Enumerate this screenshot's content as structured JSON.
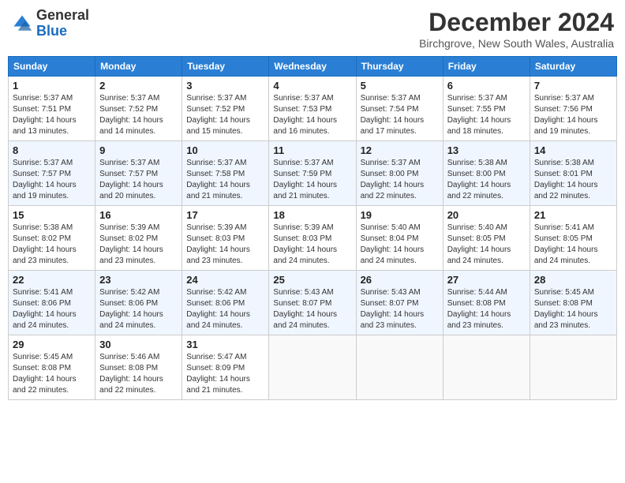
{
  "logo": {
    "general": "General",
    "blue": "Blue"
  },
  "header": {
    "month": "December 2024",
    "location": "Birchgrove, New South Wales, Australia"
  },
  "weekdays": [
    "Sunday",
    "Monday",
    "Tuesday",
    "Wednesday",
    "Thursday",
    "Friday",
    "Saturday"
  ],
  "weeks": [
    [
      {
        "day": "1",
        "info": "Sunrise: 5:37 AM\nSunset: 7:51 PM\nDaylight: 14 hours\nand 13 minutes."
      },
      {
        "day": "2",
        "info": "Sunrise: 5:37 AM\nSunset: 7:52 PM\nDaylight: 14 hours\nand 14 minutes."
      },
      {
        "day": "3",
        "info": "Sunrise: 5:37 AM\nSunset: 7:52 PM\nDaylight: 14 hours\nand 15 minutes."
      },
      {
        "day": "4",
        "info": "Sunrise: 5:37 AM\nSunset: 7:53 PM\nDaylight: 14 hours\nand 16 minutes."
      },
      {
        "day": "5",
        "info": "Sunrise: 5:37 AM\nSunset: 7:54 PM\nDaylight: 14 hours\nand 17 minutes."
      },
      {
        "day": "6",
        "info": "Sunrise: 5:37 AM\nSunset: 7:55 PM\nDaylight: 14 hours\nand 18 minutes."
      },
      {
        "day": "7",
        "info": "Sunrise: 5:37 AM\nSunset: 7:56 PM\nDaylight: 14 hours\nand 19 minutes."
      }
    ],
    [
      {
        "day": "8",
        "info": "Sunrise: 5:37 AM\nSunset: 7:57 PM\nDaylight: 14 hours\nand 19 minutes."
      },
      {
        "day": "9",
        "info": "Sunrise: 5:37 AM\nSunset: 7:57 PM\nDaylight: 14 hours\nand 20 minutes."
      },
      {
        "day": "10",
        "info": "Sunrise: 5:37 AM\nSunset: 7:58 PM\nDaylight: 14 hours\nand 21 minutes."
      },
      {
        "day": "11",
        "info": "Sunrise: 5:37 AM\nSunset: 7:59 PM\nDaylight: 14 hours\nand 21 minutes."
      },
      {
        "day": "12",
        "info": "Sunrise: 5:37 AM\nSunset: 8:00 PM\nDaylight: 14 hours\nand 22 minutes."
      },
      {
        "day": "13",
        "info": "Sunrise: 5:38 AM\nSunset: 8:00 PM\nDaylight: 14 hours\nand 22 minutes."
      },
      {
        "day": "14",
        "info": "Sunrise: 5:38 AM\nSunset: 8:01 PM\nDaylight: 14 hours\nand 22 minutes."
      }
    ],
    [
      {
        "day": "15",
        "info": "Sunrise: 5:38 AM\nSunset: 8:02 PM\nDaylight: 14 hours\nand 23 minutes."
      },
      {
        "day": "16",
        "info": "Sunrise: 5:39 AM\nSunset: 8:02 PM\nDaylight: 14 hours\nand 23 minutes."
      },
      {
        "day": "17",
        "info": "Sunrise: 5:39 AM\nSunset: 8:03 PM\nDaylight: 14 hours\nand 23 minutes."
      },
      {
        "day": "18",
        "info": "Sunrise: 5:39 AM\nSunset: 8:03 PM\nDaylight: 14 hours\nand 24 minutes."
      },
      {
        "day": "19",
        "info": "Sunrise: 5:40 AM\nSunset: 8:04 PM\nDaylight: 14 hours\nand 24 minutes."
      },
      {
        "day": "20",
        "info": "Sunrise: 5:40 AM\nSunset: 8:05 PM\nDaylight: 14 hours\nand 24 minutes."
      },
      {
        "day": "21",
        "info": "Sunrise: 5:41 AM\nSunset: 8:05 PM\nDaylight: 14 hours\nand 24 minutes."
      }
    ],
    [
      {
        "day": "22",
        "info": "Sunrise: 5:41 AM\nSunset: 8:06 PM\nDaylight: 14 hours\nand 24 minutes."
      },
      {
        "day": "23",
        "info": "Sunrise: 5:42 AM\nSunset: 8:06 PM\nDaylight: 14 hours\nand 24 minutes."
      },
      {
        "day": "24",
        "info": "Sunrise: 5:42 AM\nSunset: 8:06 PM\nDaylight: 14 hours\nand 24 minutes."
      },
      {
        "day": "25",
        "info": "Sunrise: 5:43 AM\nSunset: 8:07 PM\nDaylight: 14 hours\nand 24 minutes."
      },
      {
        "day": "26",
        "info": "Sunrise: 5:43 AM\nSunset: 8:07 PM\nDaylight: 14 hours\nand 23 minutes."
      },
      {
        "day": "27",
        "info": "Sunrise: 5:44 AM\nSunset: 8:08 PM\nDaylight: 14 hours\nand 23 minutes."
      },
      {
        "day": "28",
        "info": "Sunrise: 5:45 AM\nSunset: 8:08 PM\nDaylight: 14 hours\nand 23 minutes."
      }
    ],
    [
      {
        "day": "29",
        "info": "Sunrise: 5:45 AM\nSunset: 8:08 PM\nDaylight: 14 hours\nand 22 minutes."
      },
      {
        "day": "30",
        "info": "Sunrise: 5:46 AM\nSunset: 8:08 PM\nDaylight: 14 hours\nand 22 minutes."
      },
      {
        "day": "31",
        "info": "Sunrise: 5:47 AM\nSunset: 8:09 PM\nDaylight: 14 hours\nand 21 minutes."
      },
      null,
      null,
      null,
      null
    ]
  ]
}
